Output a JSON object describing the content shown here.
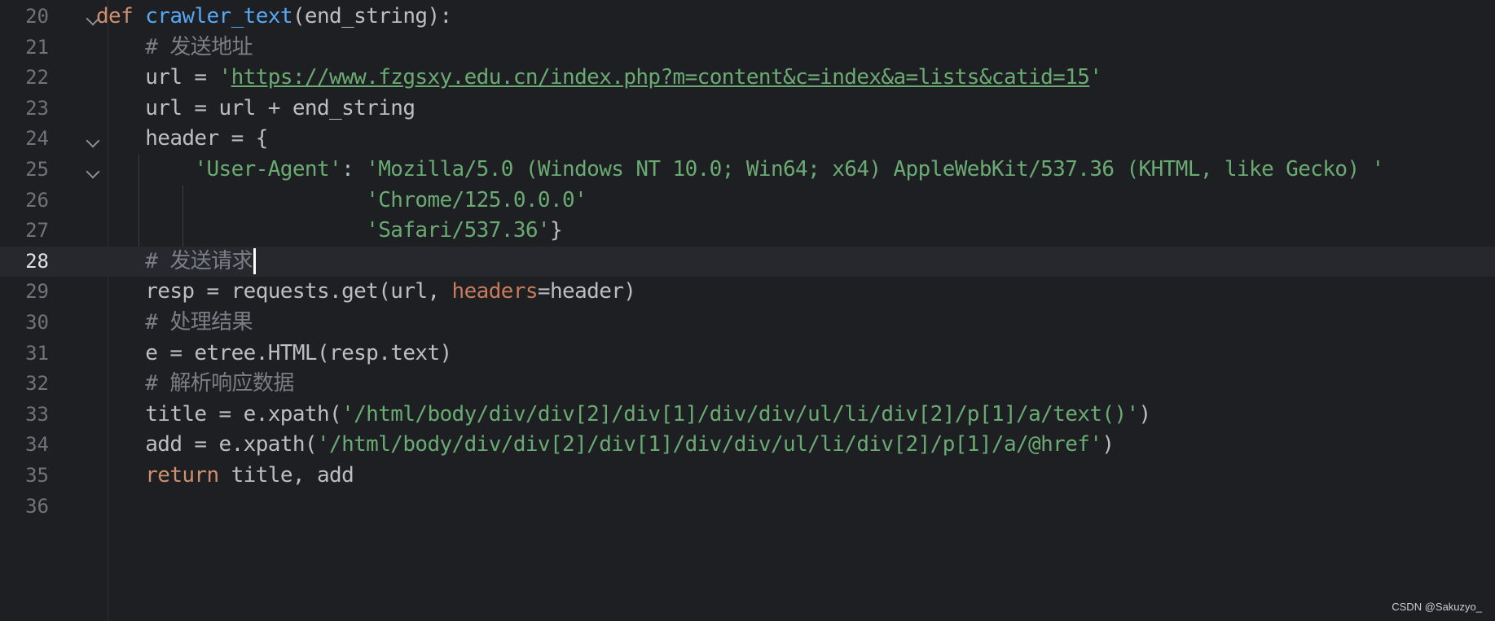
{
  "editor": {
    "lines": [
      {
        "number": "20",
        "parts": [
          {
            "t": "def",
            "c": "kw"
          },
          {
            "t": " ",
            "c": ""
          },
          {
            "t": "crawler_text",
            "c": "fn"
          },
          {
            "t": "(end_string):",
            "c": ""
          }
        ]
      },
      {
        "number": "21",
        "parts": [
          {
            "t": "    ",
            "c": ""
          },
          {
            "t": "# 发送地址",
            "c": "cmt"
          }
        ]
      },
      {
        "number": "22",
        "parts": [
          {
            "t": "    url = ",
            "c": ""
          },
          {
            "t": "'",
            "c": "str"
          },
          {
            "t": "https://www.fzgsxy.edu.cn/index.php?m=content&c=index&a=lists&catid=15",
            "c": "str link"
          },
          {
            "t": "'",
            "c": "str"
          }
        ]
      },
      {
        "number": "23",
        "parts": [
          {
            "t": "    url = url + end_string",
            "c": ""
          }
        ]
      },
      {
        "number": "24",
        "parts": [
          {
            "t": "    header = {",
            "c": ""
          }
        ]
      },
      {
        "number": "25",
        "parts": [
          {
            "t": "        ",
            "c": ""
          },
          {
            "t": "'User-Agent'",
            "c": "str"
          },
          {
            "t": ": ",
            "c": ""
          },
          {
            "t": "'Mozilla/5.0 (Windows NT 10.0; Win64; x64) AppleWebKit/537.36 (KHTML, like Gecko) '",
            "c": "str"
          }
        ]
      },
      {
        "number": "26",
        "parts": [
          {
            "t": "                      ",
            "c": ""
          },
          {
            "t": "'Chrome/125.0.0.0'",
            "c": "str"
          }
        ]
      },
      {
        "number": "27",
        "parts": [
          {
            "t": "                      ",
            "c": ""
          },
          {
            "t": "'Safari/537.36'",
            "c": "str"
          },
          {
            "t": "}",
            "c": ""
          }
        ]
      },
      {
        "number": "28",
        "parts": [
          {
            "t": "    ",
            "c": ""
          },
          {
            "t": "# 发送请求",
            "c": "cmt"
          }
        ]
      },
      {
        "number": "29",
        "parts": [
          {
            "t": "    resp = requests.get(url, ",
            "c": ""
          },
          {
            "t": "headers",
            "c": "param"
          },
          {
            "t": "=header)",
            "c": ""
          }
        ]
      },
      {
        "number": "30",
        "parts": [
          {
            "t": "    ",
            "c": ""
          },
          {
            "t": "# 处理结果",
            "c": "cmt"
          }
        ]
      },
      {
        "number": "31",
        "parts": [
          {
            "t": "    e = etree.HTML(resp.text)",
            "c": ""
          }
        ]
      },
      {
        "number": "32",
        "parts": [
          {
            "t": "    ",
            "c": ""
          },
          {
            "t": "# 解析响应数据",
            "c": "cmt"
          }
        ]
      },
      {
        "number": "33",
        "parts": [
          {
            "t": "    title = e.xpath(",
            "c": ""
          },
          {
            "t": "'/html/body/div/div[2]/div[1]/div/div/ul/li/div[2]/p[1]/a/text()'",
            "c": "str"
          },
          {
            "t": ")",
            "c": ""
          }
        ]
      },
      {
        "number": "34",
        "parts": [
          {
            "t": "    add = e.xpath(",
            "c": ""
          },
          {
            "t": "'/html/body/div/div[2]/div[1]/div/div/ul/li/div[2]/p[1]/a/@href'",
            "c": "str"
          },
          {
            "t": ")",
            "c": ""
          }
        ]
      },
      {
        "number": "35",
        "parts": [
          {
            "t": "    ",
            "c": ""
          },
          {
            "t": "return",
            "c": "kw"
          },
          {
            "t": " title, add",
            "c": ""
          }
        ]
      },
      {
        "number": "36",
        "parts": []
      }
    ],
    "current_line": "28"
  },
  "watermark": "CSDN @Sakuzyo_",
  "colors": {
    "background": "#1e1f22",
    "keyword": "#cf8e6d",
    "function": "#56a8f5",
    "string": "#6aab73",
    "comment": "#7a7e85",
    "param": "#c77b59"
  },
  "icons": {
    "fold_marker": "chevron-down-icon",
    "text_caret": "text-caret"
  }
}
